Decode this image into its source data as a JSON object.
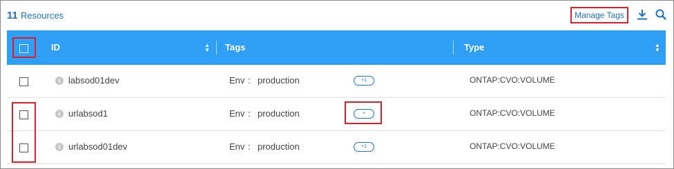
{
  "header": {
    "resource_count": "11",
    "resource_label": "Resources",
    "manage_tags_label": "Manage Tags",
    "download_icon": "download-icon",
    "search_icon": "search-icon"
  },
  "table": {
    "columns": [
      {
        "label": "ID"
      },
      {
        "label": "Tags"
      },
      {
        "label": "Type"
      }
    ],
    "rows": [
      {
        "id": "labsod01dev",
        "tag_key": "Env",
        "tag_sep": ":",
        "tag_value": "production",
        "more": "+1",
        "type": "ONTAP:CVO:VOLUME"
      },
      {
        "id": "urlabsod1",
        "tag_key": "Env",
        "tag_sep": ":",
        "tag_value": "production",
        "more": "+",
        "type": "ONTAP:CVO:VOLUME"
      },
      {
        "id": "urlabsod01dev",
        "tag_key": "Env",
        "tag_sep": ":",
        "tag_value": "production",
        "more": "+1",
        "type": "ONTAP:CVO:VOLUME"
      }
    ]
  },
  "colors": {
    "header_bg": "#2f9ef5",
    "accent": "#1a73c8",
    "highlight": "#d9202a"
  }
}
